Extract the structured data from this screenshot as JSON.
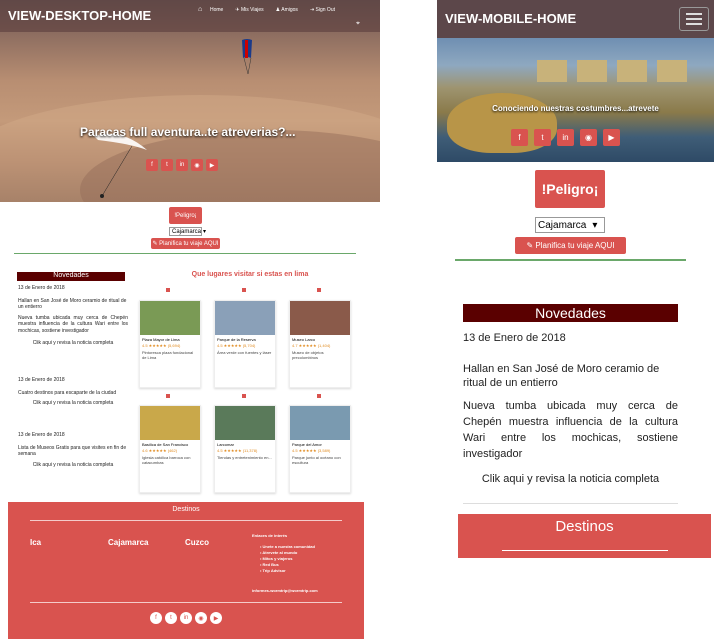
{
  "desktop": {
    "brand": "VIEW-DESKTOP-HOME",
    "nav": [
      {
        "icon": "home-icon",
        "label": "Home"
      },
      {
        "icon": "plane-icon",
        "label": "Mis Viajes"
      },
      {
        "icon": "users-icon",
        "label": "Amigos"
      },
      {
        "icon": "sign-out-icon",
        "label": "Sign Out"
      }
    ],
    "hero_title": "Paracas full aventura..te atreverias?...",
    "peligro": "!Peligro¡",
    "select": "Cajamarca",
    "plan": "✎ Planifica tu viaje AQUI",
    "novedades": "Novedades",
    "news": [
      {
        "date": "13 de Enero de 2018",
        "lines": [
          "Hallan en San José de Moro ceramio de ritual de un entierro",
          "Nueva tumba ubicada muy cerca de Chepén muestra influencia de la cultura Wari entre los mochicas, sostiene investigador"
        ],
        "link": "Clik aqui y revisa la noticia completa"
      },
      {
        "date": "13 de Enero de 2018",
        "lines": [
          "Cuatro destinos para escaparte de la ciudad"
        ],
        "link": "Clik aqui y revisa la noticia completa"
      },
      {
        "date": "13 de Enero de 2018",
        "lines": [
          "Lista de Museos Gratis para que visites en fin de semana"
        ],
        "link": "Clik aqui y revisa la noticia completa"
      }
    ],
    "places_title": "Que lugares visitar si estas en lima",
    "places": [
      {
        "name": "Plaza Mayor de Lima",
        "rating": "4.5 ★★★★★ (5,694)",
        "desc": "Pintoresca plaza fundacional de Lima",
        "color": "#7a9a55"
      },
      {
        "name": "Parque de la Reserva",
        "rating": "4.5 ★★★★★ (5,704)",
        "desc": "Área verde con fuentes y láser",
        "color": "#8aa0b8"
      },
      {
        "name": "Museo Larco",
        "rating": "4.7 ★★★★★ (1,404)",
        "desc": "Museo de objetos precolombinos",
        "color": "#8a5a4a"
      },
      {
        "name": "Basílica de San Francisco",
        "rating": "4.6 ★★★★★ (462)",
        "desc": "Iglesia católica barroca con catacumbas",
        "color": "#c9a84a"
      },
      {
        "name": "Larcomar",
        "rating": "4.5 ★★★★★ (11,378)",
        "desc": "Tiendas y entretenimiento en...",
        "color": "#5a7a5a"
      },
      {
        "name": "Parque del Amor",
        "rating": "4.5 ★★★★★ (3,589)",
        "desc": "Parque junto al océano con escultura",
        "color": "#7a9ab0"
      }
    ],
    "footer": {
      "title": "Destinos",
      "cities": [
        "Ica",
        "Cajamarca",
        "Cuzco"
      ],
      "links_title": "Enlaces de interés",
      "links": [
        "Unete a nuestra comunidad",
        "Atrevete al mundo",
        "Mitos y viajeros",
        "Red Bus",
        "Trip Advisor"
      ],
      "email": "informes-wormtrip@wormtrip.com"
    },
    "social": [
      "f",
      "t",
      "in",
      "◉",
      "▶"
    ]
  },
  "mobile": {
    "brand": "VIEW-MOBILE-HOME",
    "hero_caption": "Conociendo nuestras costumbres...atrevete",
    "social": [
      "f",
      "t",
      "in",
      "◉",
      "▶"
    ],
    "peligro": "!Peligro¡",
    "select": "Cajamarca",
    "plan": "✎ Planifica tu viaje AQUI",
    "novedades": "Novedades",
    "date": "13 de Enero de 2018",
    "headline": "Hallan en San José de Moro ceramio de ritual de un entierro",
    "body": "Nueva tumba ubicada muy cerca de Chepén muestra influencia de la cultura Wari entre los mochicas, sostiene investigador",
    "link": "Clik aqui y revisa la noticia completa",
    "destinos": "Destinos"
  }
}
